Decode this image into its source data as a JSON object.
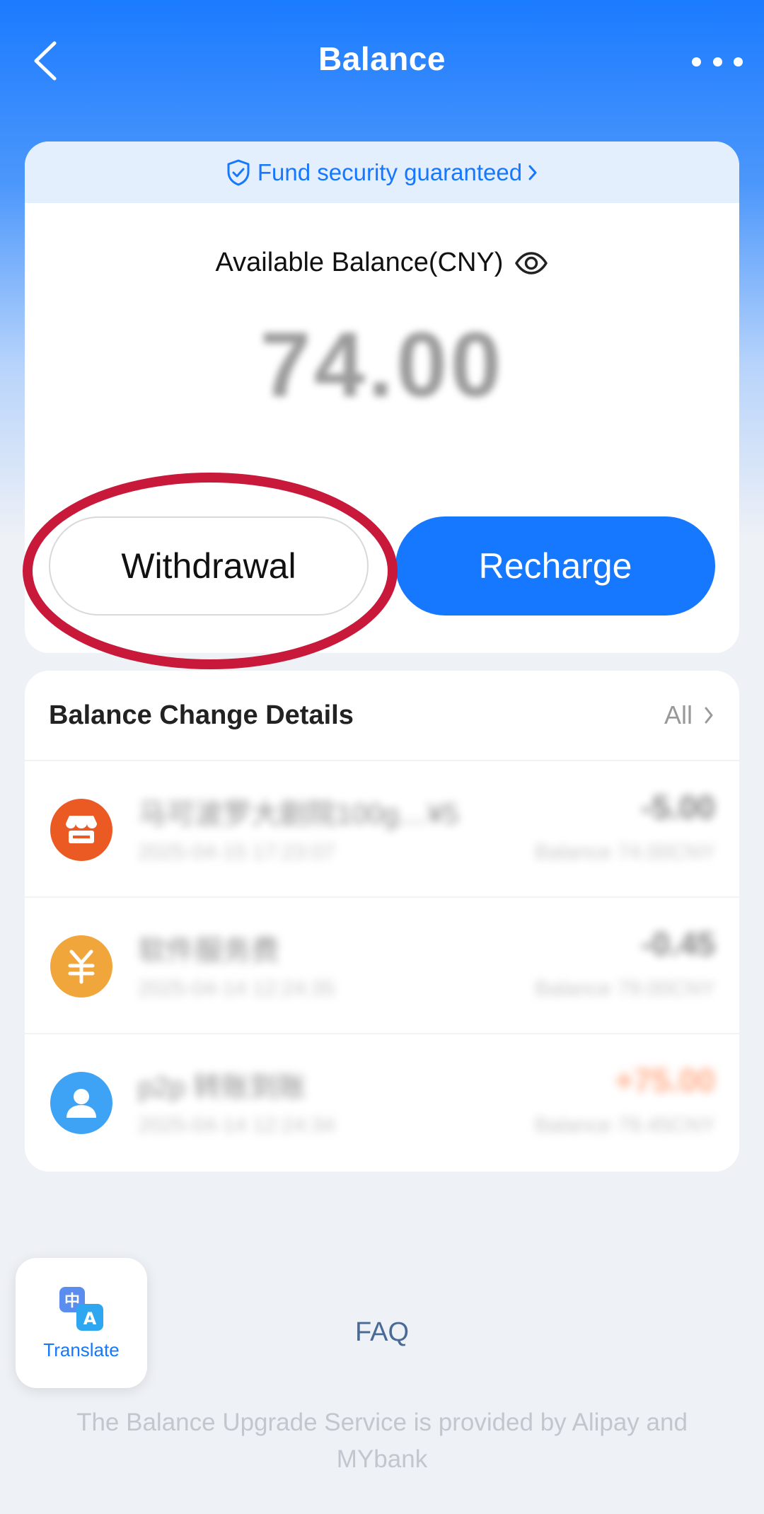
{
  "header": {
    "title": "Balance"
  },
  "security_banner": {
    "text": "Fund security guaranteed"
  },
  "balance": {
    "label": "Available Balance(CNY)",
    "amount": "74.00"
  },
  "actions": {
    "withdraw_label": "Withdrawal",
    "recharge_label": "Recharge"
  },
  "details": {
    "title": "Balance Change Details",
    "all_label": "All"
  },
  "transactions": [
    {
      "icon": "store-icon",
      "color": "#ec5a24",
      "name": "马可波罗大剧院100g…¥5",
      "time": "2025-04-15 17:23:07",
      "amount": "-5.00",
      "balance": "Balance 74.00CNY"
    },
    {
      "icon": "yuan-icon",
      "color": "#f0a63a",
      "name": "软件服务费",
      "time": "2025-04-14 12:24:35",
      "amount": "-0.45",
      "balance": "Balance 79.00CNY"
    },
    {
      "icon": "user-icon",
      "color": "#3ea3f5",
      "name": "p2p 转账到账",
      "time": "2025-04-14 12:24:34",
      "amount": "+75.00",
      "balance": "Balance 79.45CNY"
    }
  ],
  "translate": {
    "label": "Translate"
  },
  "faq": {
    "label": "FAQ"
  },
  "footer": {
    "text": "The Balance Upgrade Service is provided by Alipay and MYbank"
  },
  "colors": {
    "brand_blue": "#1677ff",
    "highlight_red": "#c8193a"
  }
}
